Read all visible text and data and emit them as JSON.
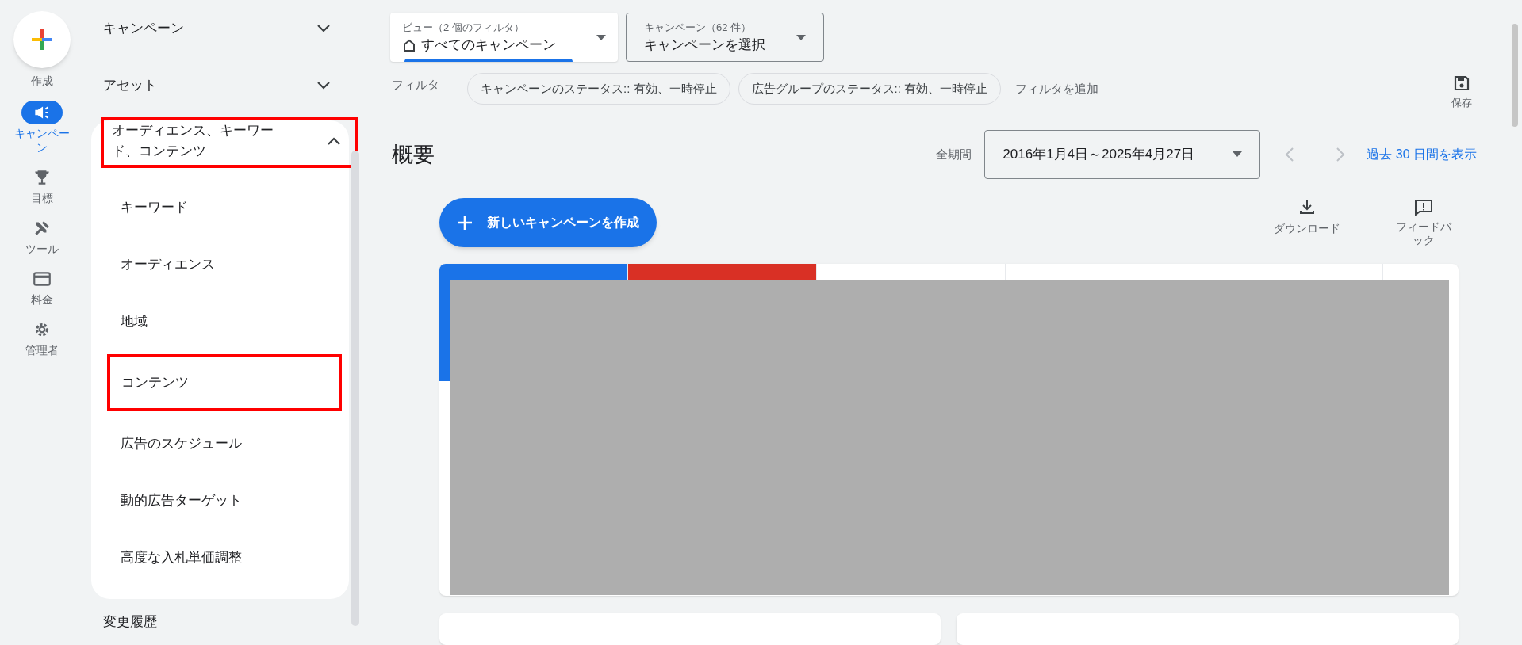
{
  "rail": {
    "create_label": "作成",
    "items": [
      {
        "label": "キャンペーン",
        "selected": true
      },
      {
        "label": "目標",
        "selected": false
      },
      {
        "label": "ツール",
        "selected": false
      },
      {
        "label": "料金",
        "selected": false
      },
      {
        "label": "管理者",
        "selected": false
      }
    ]
  },
  "nav": {
    "sections": [
      {
        "label": "キャンペーン",
        "expanded": false,
        "highlighted": false
      },
      {
        "label": "アセット",
        "expanded": false,
        "highlighted": false
      },
      {
        "label": "オーディエンス、キーワード、コンテンツ",
        "expanded": true,
        "highlighted": true,
        "children": [
          {
            "label": "キーワード",
            "highlighted": false
          },
          {
            "label": "オーディエンス",
            "highlighted": false
          },
          {
            "label": "地域",
            "highlighted": false
          },
          {
            "label": "コンテンツ",
            "highlighted": true
          },
          {
            "label": "広告のスケジュール",
            "highlighted": false
          },
          {
            "label": "動的広告ターゲット",
            "highlighted": false
          },
          {
            "label": "高度な入札単価調整",
            "highlighted": false
          }
        ]
      }
    ],
    "footer_item": "変更履歴"
  },
  "view_selector": {
    "label": "ビュー（2 個のフィルタ）",
    "value": "すべてのキャンペーン"
  },
  "campaign_selector": {
    "label": "キャンペーン（62 件）",
    "value": "キャンペーンを選択"
  },
  "filters": {
    "label": "フィルタ",
    "chips": [
      "キャンペーンのステータス:: 有効、一時停止",
      "広告グループのステータス:: 有効、一時停止"
    ],
    "add_label": "フィルタを追加",
    "save_label": "保存"
  },
  "overview": {
    "title": "概要",
    "period_label": "全期間",
    "date_range": "2016年1月4日～2025年4月27日",
    "recent_link": "過去 30 日間を表示"
  },
  "actions": {
    "new_campaign": "新しいキャンペーンを作成",
    "download": "ダウンロード",
    "feedback": "フィードバック"
  },
  "metric_tabs": [
    {
      "selected": true,
      "color": "#1a73e8"
    },
    {
      "selected": true,
      "color": "#d93025"
    },
    {
      "selected": false
    },
    {
      "selected": false
    },
    {
      "selected": false
    }
  ]
}
